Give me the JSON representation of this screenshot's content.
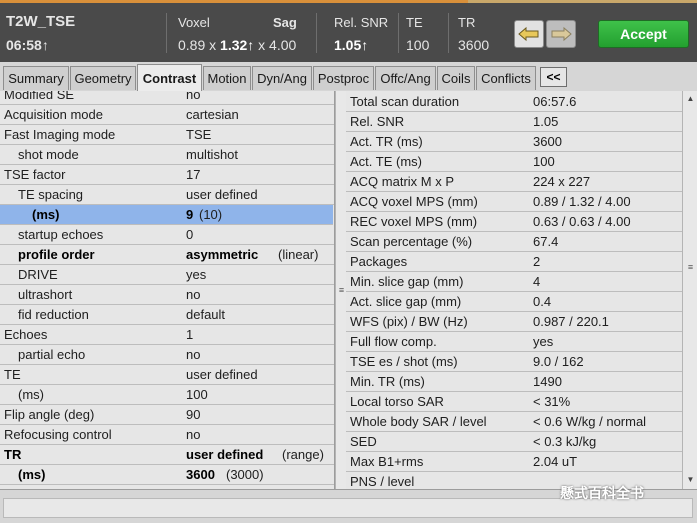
{
  "header": {
    "title": "T2W_TSE",
    "time": "06:58",
    "voxel_label": "Voxel",
    "voxel_values": [
      "0.89 x ",
      "1.32",
      " x 4.00"
    ],
    "orientation": "Sag",
    "rel_snr_label": "Rel. SNR",
    "rel_snr_value": "1.05",
    "te_label": "TE",
    "te_value": "100",
    "tr_label": "TR",
    "tr_value": "3600",
    "accept_label": "Accept",
    "up_arrow": "↑"
  },
  "tabs": [
    "Summary",
    "Geometry",
    "Contrast",
    "Motion",
    "Dyn/Ang",
    "Postproc",
    "Offc/Ang",
    "Coils",
    "Conflicts"
  ],
  "collapse_label": "<<",
  "left_rows": [
    {
      "label": "Modified SE",
      "value": "no"
    },
    {
      "label": "Acquisition  mode",
      "value": "cartesian"
    },
    {
      "label": "Fast Imaging mode",
      "value": "TSE"
    },
    {
      "label": "shot mode",
      "value": "multishot"
    },
    {
      "label": "TSE factor",
      "value": "17"
    },
    {
      "label": "TE spacing",
      "value": "user defined"
    },
    {
      "label": "(ms)",
      "value": "9",
      "extra": "(10)"
    },
    {
      "label": "startup echoes",
      "value": "0"
    },
    {
      "label": "profile order",
      "value": "asymmetric",
      "extra": "(linear)"
    },
    {
      "label": "DRIVE",
      "value": "yes"
    },
    {
      "label": "ultrashort",
      "value": "no"
    },
    {
      "label": "fid reduction",
      "value": "default"
    },
    {
      "label": "Echoes",
      "value": "1"
    },
    {
      "label": "partial echo",
      "value": "no"
    },
    {
      "label": "TE",
      "value": "user defined"
    },
    {
      "label": "(ms)",
      "value": "100"
    },
    {
      "label": "Flip angle (deg)",
      "value": "90"
    },
    {
      "label": "Refocusing  control",
      "value": "no"
    },
    {
      "label": "TR",
      "value": "user defined",
      "extra": "(range)"
    },
    {
      "label": "(ms)",
      "value": "3600",
      "extra": "(3000)"
    }
  ],
  "right_rows": [
    {
      "label": "Total scan  duration",
      "value": "06:57.6"
    },
    {
      "label": "Rel. SNR",
      "value": "1.05"
    },
    {
      "label": "Act. TR (ms)",
      "value": "3600"
    },
    {
      "label": "Act. TE (ms)",
      "value": "100"
    },
    {
      "label": "ACQ matrix M x P",
      "value": "224 x 227"
    },
    {
      "label": "ACQ voxel MPS (mm)",
      "value": "0.89 / 1.32 / 4.00"
    },
    {
      "label": "REC voxel MPS (mm)",
      "value": "0.63 / 0.63 / 4.00"
    },
    {
      "label": "Scan percentage (%)",
      "value": "67.4"
    },
    {
      "label": "Packages",
      "value": "2"
    },
    {
      "label": "Min. slice gap (mm)",
      "value": "4"
    },
    {
      "label": "Act. slice gap (mm)",
      "value": "0.4"
    },
    {
      "label": "WFS (pix) / BW (Hz)",
      "value": "0.987 / 220.1"
    },
    {
      "label": "Full flow comp.",
      "value": "yes"
    },
    {
      "label": "TSE es / shot (ms)",
      "value": "9.0 / 162"
    },
    {
      "label": "Min. TR (ms)",
      "value": "1490"
    },
    {
      "label": "Local torso SAR",
      "value": "< 31%"
    },
    {
      "label": "Whole body SAR / level",
      "value": "< 0.6 W/kg / normal"
    },
    {
      "label": "SED",
      "value": "< 0.3 kJ/kg"
    },
    {
      "label": "Max B1+rms",
      "value": "2.04 uT"
    },
    {
      "label": "PNS / level",
      "value": ""
    }
  ],
  "watermark": "懸式百科全书",
  "colors": {
    "accept": "#2fb23b",
    "highlight": "#8fb4ea",
    "header": "#4a4a4a"
  }
}
